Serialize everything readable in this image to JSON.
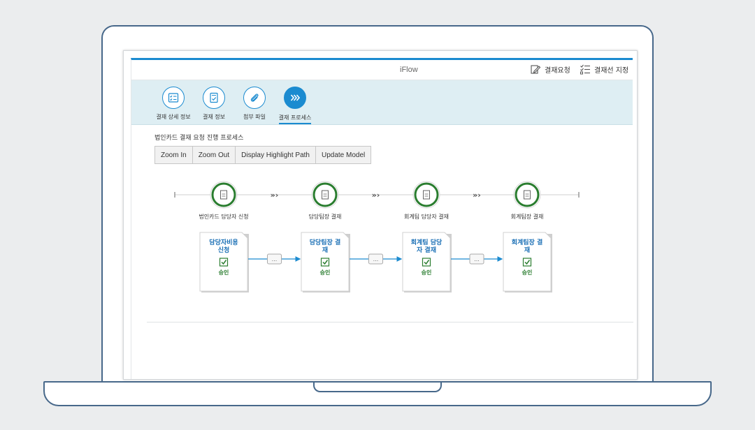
{
  "app": {
    "title": "iFlow"
  },
  "top_actions": [
    {
      "label": "결재요청",
      "icon": "edit-icon"
    },
    {
      "label": "결재선 지정",
      "icon": "checklist-icon"
    }
  ],
  "tabs": [
    {
      "label": "결재 상세 정보",
      "icon": "checklist-icon",
      "active": false
    },
    {
      "label": "결재 정보",
      "icon": "document-check-icon",
      "active": false
    },
    {
      "label": "첨부 파일",
      "icon": "paperclip-icon",
      "active": false
    },
    {
      "label": "결재 프로세스",
      "icon": "chevrons-right-icon",
      "active": true
    }
  ],
  "process": {
    "title": "법인카드 결재 요청 진행 프로세스",
    "buttons": [
      "Zoom In",
      "Zoom Out",
      "Display Highlight Path",
      "Update Model"
    ],
    "stages": [
      {
        "label": "법인카드 담당자 신청",
        "card_title": [
          "담당자비용",
          "신청"
        ],
        "status": "승인"
      },
      {
        "label": "담당팀장 결재",
        "card_title": [
          "담당팀장 결",
          "재"
        ],
        "status": "승인"
      },
      {
        "label": "회계팀 담당자 결재",
        "card_title": [
          "회계팀 담당",
          "자 결재"
        ],
        "status": "승인"
      },
      {
        "label": "회계팀장 결재",
        "card_title": [
          "회계팀장 결",
          "재"
        ],
        "status": "승인"
      }
    ],
    "connector_label": "...",
    "colors": {
      "accent": "#1b8bd0",
      "complete": "#2a7d2f",
      "card_title": "#1a6fb5"
    }
  }
}
